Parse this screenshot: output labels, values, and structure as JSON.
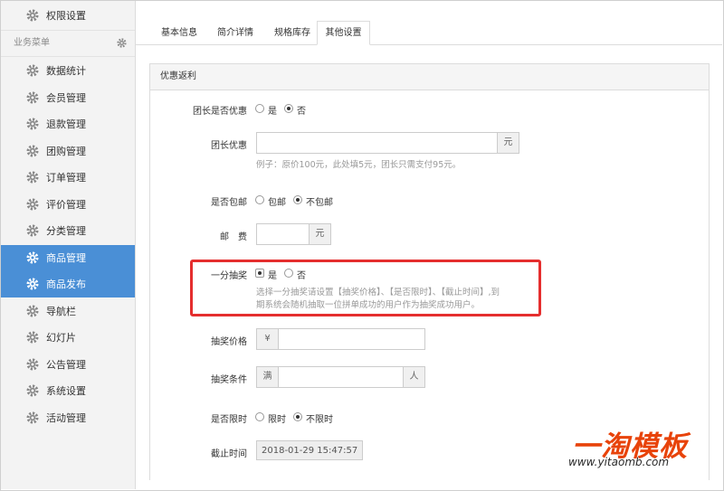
{
  "sidebar": {
    "top_item": "权限设置",
    "section_label": "业务菜单",
    "items": [
      {
        "label": "数据统计"
      },
      {
        "label": "会员管理"
      },
      {
        "label": "退款管理"
      },
      {
        "label": "团购管理"
      },
      {
        "label": "订单管理"
      },
      {
        "label": "评价管理"
      },
      {
        "label": "分类管理"
      },
      {
        "label": "商品管理",
        "active": true
      },
      {
        "label": "商品发布",
        "active": true
      },
      {
        "label": "导航栏"
      },
      {
        "label": "幻灯片"
      },
      {
        "label": "公告管理"
      },
      {
        "label": "系统设置"
      },
      {
        "label": "活动管理"
      }
    ]
  },
  "tabs": [
    {
      "label": "基本信息"
    },
    {
      "label": "简介详情"
    },
    {
      "label": "规格库存"
    },
    {
      "label": "其他设置",
      "active": true
    }
  ],
  "panel": {
    "title": "优惠返利",
    "leader_discount": {
      "label": "团长是否优惠",
      "options": [
        "是",
        "否"
      ],
      "selected": "否"
    },
    "leader_amount": {
      "label": "团长优惠",
      "unit": "元",
      "value": "",
      "help": "例子：原价100元，此处填5元，团长只需支付95元。"
    },
    "free_shipping": {
      "label": "是否包邮",
      "options": [
        "包邮",
        "不包邮"
      ],
      "selected": "不包邮"
    },
    "postage": {
      "label": "邮　费",
      "unit": "元",
      "value": ""
    },
    "lottery": {
      "label": "一分抽奖",
      "options": [
        "是",
        "否"
      ],
      "selected": "是",
      "help": [
        "选择一分抽奖请设置【抽奖价格】、【是否限时】、【截止时间】,到",
        "期系统会随机抽取一位拼单成功的用户作为抽奖成功用户。"
      ]
    },
    "lottery_price": {
      "label": "抽奖价格",
      "prefix": "¥",
      "value": ""
    },
    "lottery_condition": {
      "label": "抽奖条件",
      "prefix": "满",
      "unit": "人",
      "value": ""
    },
    "time_limit": {
      "label": "是否限时",
      "options": [
        "限时",
        "不限时"
      ],
      "selected": "不限时"
    },
    "deadline": {
      "label": "截止时间",
      "value": "2018-01-29 15:47:57"
    }
  },
  "watermark": {
    "logo": "一淘模板",
    "url": "www.yitaomb.com"
  },
  "colors": {
    "accent": "#4a8fd6",
    "highlight": "#e52e2e",
    "brand": "#e8430a"
  }
}
